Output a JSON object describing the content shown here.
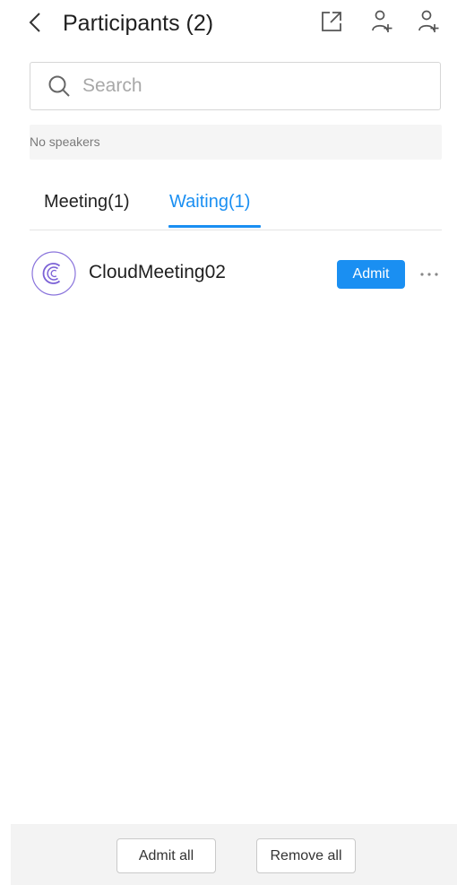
{
  "header": {
    "title": "Participants (2)",
    "icons": [
      "back-chevron-icon",
      "share-icon",
      "add-user-icon",
      "invite-user-icon"
    ]
  },
  "search": {
    "placeholder": "Search",
    "value": ""
  },
  "speakers": {
    "text": "No speakers"
  },
  "tabs": [
    {
      "label": "Meeting(1)",
      "active": false
    },
    {
      "label": "Waiting(1)",
      "active": true
    }
  ],
  "participants": [
    {
      "name": "CloudMeeting02",
      "action_label": "Admit",
      "more_icon": "more-dots-icon"
    }
  ],
  "footer": {
    "admit_all_label": "Admit all",
    "remove_all_label": "Remove all"
  },
  "colors": {
    "accent": "#1a8ff2",
    "avatar_ring": "#7b61d6",
    "muted_background": "#f5f5f5"
  }
}
